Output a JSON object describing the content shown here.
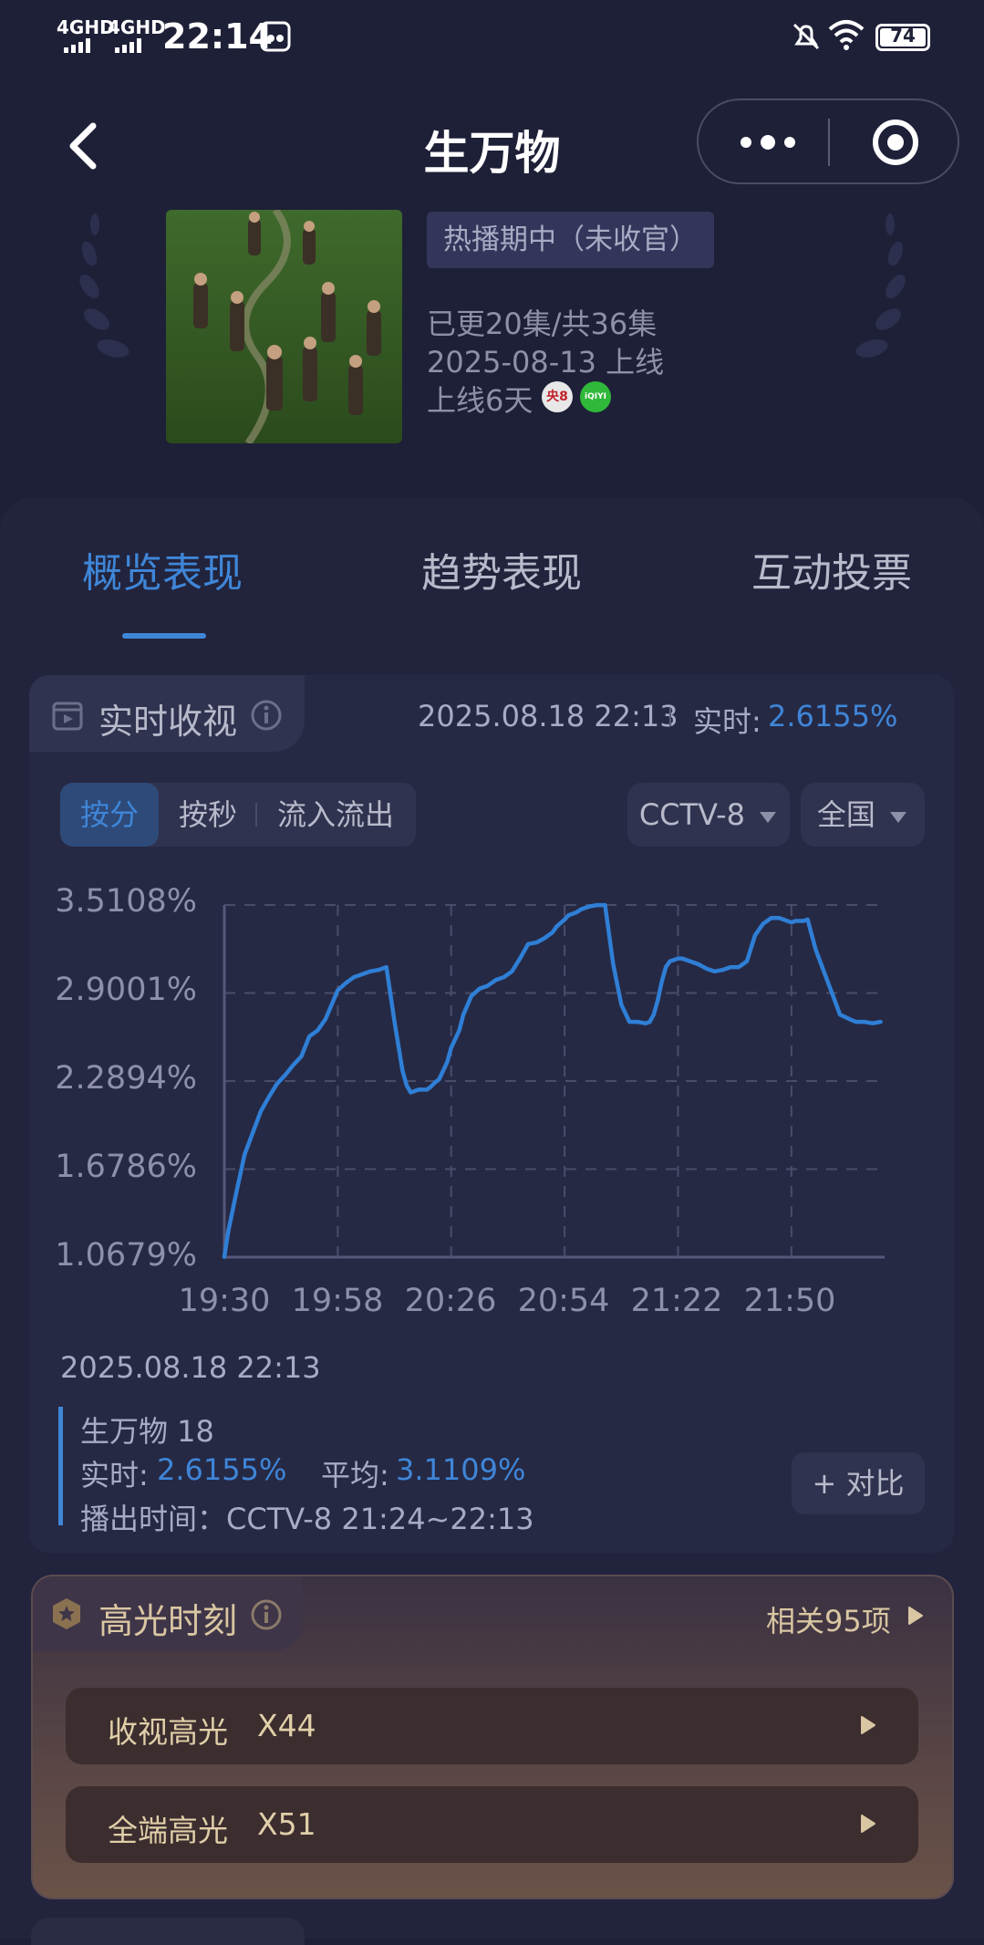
{
  "status_bar": {
    "signal1": "4GHD",
    "signal2": "4GHD",
    "time": "22:14",
    "battery": "74"
  },
  "header": {
    "title": "生万物"
  },
  "show": {
    "badge": "热播期中（未收官）",
    "episodes": "已更20集/共36集",
    "release": "2025-08-13 上线",
    "days_online": "上线6天",
    "channel_icon_text": "央8",
    "platform_icon_text": "iQIYI"
  },
  "tabs": [
    {
      "label": "概览表现",
      "active": true
    },
    {
      "label": "趋势表现",
      "active": false
    },
    {
      "label": "互动投票",
      "active": false
    }
  ],
  "realtime": {
    "title": "实时收视",
    "timestamp": "2025.08.18 22:13",
    "realtime_label": "实时:",
    "realtime_value": "2.6155%",
    "segments": [
      {
        "label": "按分",
        "active": true
      },
      {
        "label": "按秒",
        "active": false
      },
      {
        "label": "流入流出",
        "active": false
      }
    ],
    "channel_dropdown": "CCTV-8",
    "region_dropdown": "全国"
  },
  "chart_data": {
    "type": "line",
    "y_ticks": [
      "3.5108%",
      "2.9001%",
      "2.2894%",
      "1.6786%",
      "1.0679%"
    ],
    "x_ticks": [
      "19:30",
      "19:58",
      "20:26",
      "20:54",
      "21:22",
      "21:50"
    ],
    "ylim": [
      1.0679,
      3.5108
    ],
    "x_minutes_range": [
      0,
      163
    ],
    "grid": true,
    "series": [
      {
        "color": "#2f7fd6",
        "x_min": [
          0,
          1,
          3,
          5,
          7,
          9,
          11,
          13,
          15,
          17,
          19,
          21,
          23,
          25,
          28,
          30,
          32,
          34,
          36,
          38,
          40,
          42,
          44,
          45,
          46,
          48,
          50,
          51,
          52,
          53,
          55,
          56,
          58,
          59,
          61,
          63,
          65,
          67,
          69,
          71,
          73,
          75,
          77,
          79,
          81,
          82,
          84,
          85,
          87,
          88,
          90,
          92,
          94,
          96,
          98,
          100,
          102,
          104,
          105,
          106,
          107,
          108,
          109,
          110,
          112,
          113,
          115,
          117,
          119,
          121,
          123,
          125,
          127,
          129,
          131,
          133,
          135,
          137,
          139,
          140,
          141,
          143,
          144,
          146,
          148,
          150,
          152,
          155,
          156,
          157,
          158,
          160,
          162
        ],
        "y": [
          1.07,
          1.25,
          1.52,
          1.78,
          1.93,
          2.08,
          2.18,
          2.27,
          2.33,
          2.4,
          2.46,
          2.6,
          2.64,
          2.72,
          2.92,
          2.97,
          3.01,
          3.03,
          3.05,
          3.06,
          3.08,
          2.7,
          2.36,
          2.26,
          2.21,
          2.23,
          2.23,
          2.25,
          2.28,
          2.3,
          2.42,
          2.52,
          2.64,
          2.75,
          2.88,
          2.93,
          2.95,
          2.99,
          3.01,
          3.05,
          3.14,
          3.24,
          3.25,
          3.28,
          3.32,
          3.36,
          3.41,
          3.44,
          3.46,
          3.48,
          3.5,
          3.51,
          3.51,
          3.1,
          2.82,
          2.7,
          2.7,
          2.69,
          2.7,
          2.75,
          2.85,
          2.98,
          3.08,
          3.12,
          3.14,
          3.14,
          3.12,
          3.1,
          3.07,
          3.05,
          3.06,
          3.08,
          3.08,
          3.12,
          3.3,
          3.38,
          3.42,
          3.42,
          3.4,
          3.39,
          3.4,
          3.4,
          3.41,
          3.2,
          3.05,
          2.9,
          2.75,
          2.71,
          2.7,
          2.7,
          2.7,
          2.69,
          2.7
        ]
      }
    ]
  },
  "program": {
    "timestamp": "2025.08.18 22:13",
    "name": "生万物 18",
    "realtime_label": "实时:",
    "realtime_value": "2.6155%",
    "avg_label": "平均:",
    "avg_value": "3.1109%",
    "airtime": "播出时间：CCTV-8 21:24~22:13",
    "compare_button": "+ 对比"
  },
  "highlights": {
    "title": "高光时刻",
    "related": "相关95项",
    "rows": [
      {
        "label": "收视高光",
        "value": "X44"
      },
      {
        "label": "全端高光",
        "value": "X51"
      }
    ]
  }
}
